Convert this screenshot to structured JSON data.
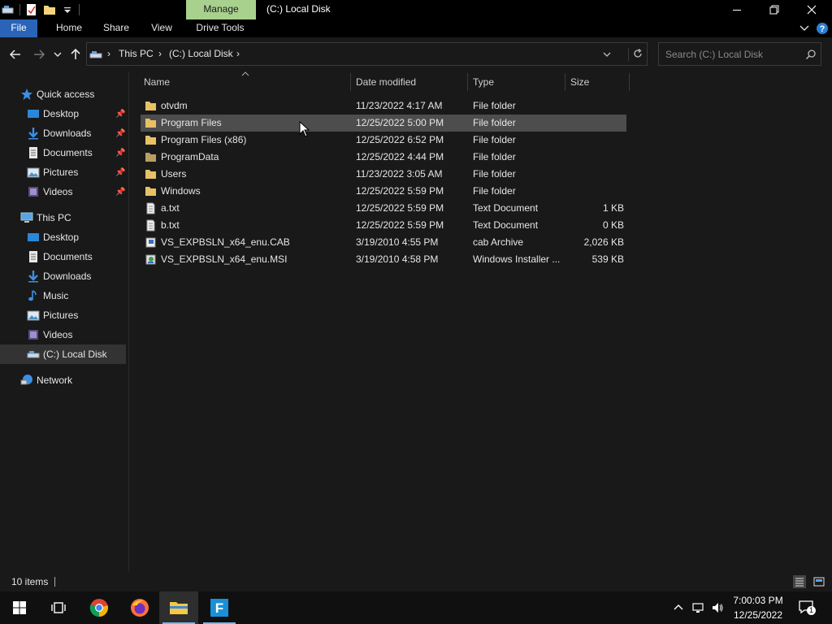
{
  "window": {
    "contextual_tab": "Manage",
    "title": "(C:) Local Disk"
  },
  "ribbon": {
    "tabs": [
      "File",
      "Home",
      "Share",
      "View",
      "Drive Tools"
    ]
  },
  "address": {
    "breadcrumbs": [
      "This PC",
      "(C:) Local Disk"
    ]
  },
  "search": {
    "placeholder": "Search (C:) Local Disk"
  },
  "nav": {
    "quick_access": "Quick access",
    "quick_items": [
      "Desktop",
      "Downloads",
      "Documents",
      "Pictures",
      "Videos"
    ],
    "this_pc": "This PC",
    "pc_items": [
      "Desktop",
      "Documents",
      "Downloads",
      "Music",
      "Pictures",
      "Videos",
      "(C:) Local Disk"
    ],
    "network": "Network"
  },
  "columns": {
    "name": "Name",
    "date": "Date modified",
    "type": "Type",
    "size": "Size"
  },
  "files": [
    {
      "name": "otvdm",
      "date": "11/23/2022 4:17 AM",
      "type": "File folder",
      "size": "",
      "icon": "folder-icon"
    },
    {
      "name": "Program Files",
      "date": "12/25/2022 5:00 PM",
      "type": "File folder",
      "size": "",
      "icon": "folder-icon"
    },
    {
      "name": "Program Files (x86)",
      "date": "12/25/2022 6:52 PM",
      "type": "File folder",
      "size": "",
      "icon": "folder-icon"
    },
    {
      "name": "ProgramData",
      "date": "12/25/2022 4:44 PM",
      "type": "File folder",
      "size": "",
      "icon": "folder-icon"
    },
    {
      "name": "Users",
      "date": "11/23/2022 3:05 AM",
      "type": "File folder",
      "size": "",
      "icon": "folder-icon"
    },
    {
      "name": "Windows",
      "date": "12/25/2022 5:59 PM",
      "type": "File folder",
      "size": "",
      "icon": "folder-icon"
    },
    {
      "name": "a.txt",
      "date": "12/25/2022 5:59 PM",
      "type": "Text Document",
      "size": "1 KB",
      "icon": "text-file-icon"
    },
    {
      "name": "b.txt",
      "date": "12/25/2022 5:59 PM",
      "type": "Text Document",
      "size": "0 KB",
      "icon": "text-file-icon"
    },
    {
      "name": "VS_EXPBSLN_x64_enu.CAB",
      "date": "3/19/2010 4:55 PM",
      "type": "cab Archive",
      "size": "2,026 KB",
      "icon": "cab-archive-icon"
    },
    {
      "name": "VS_EXPBSLN_x64_enu.MSI",
      "date": "3/19/2010 4:58 PM",
      "type": "Windows Installer ...",
      "size": "539 KB",
      "icon": "installer-icon"
    }
  ],
  "status": {
    "item_count": "10 items"
  },
  "taskbar": {
    "time": "7:00:03 PM",
    "date": "12/25/2022",
    "notification_count": "1"
  },
  "colors": {
    "accent": "#2a64b8",
    "manage_tab": "#a9d18e",
    "folder": "#e8c165",
    "hover_row": "#4d4d4d"
  }
}
